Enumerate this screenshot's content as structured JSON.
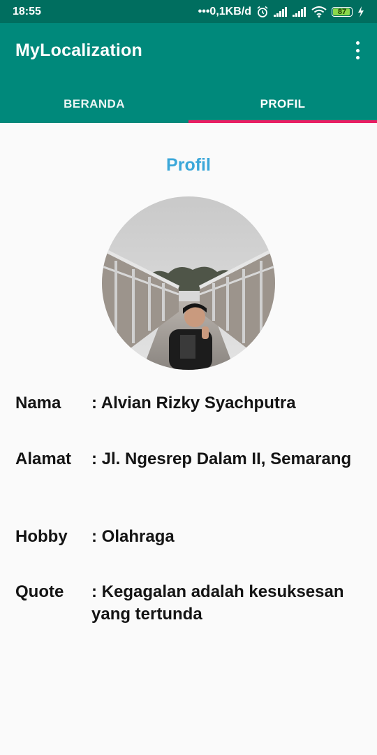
{
  "status": {
    "time": "18:55",
    "network_speed": "•••0,1KB/d",
    "battery": "87"
  },
  "app": {
    "title": "MyLocalization"
  },
  "tabs": [
    {
      "label": "BERANDA",
      "selected": false
    },
    {
      "label": "PROFIL",
      "selected": true
    }
  ],
  "colors": {
    "status_bar": "#006e5f",
    "app_bar": "#00897b",
    "tab_indicator": "#e91e63",
    "heading": "#3ba7d9"
  },
  "profile": {
    "heading": "Profil",
    "photo_icon": "profile-photo",
    "fields": [
      {
        "key": "Nama",
        "value": ": Alvian Rizky Syachputra"
      },
      {
        "key": "Alamat",
        "value": ": Jl. Ngesrep Dalam II, Semarang"
      },
      {
        "key": "Hobby",
        "value": ": Olahraga"
      },
      {
        "key": "Quote",
        "value": ": Kegagalan adalah kesuksesan yang tertunda"
      }
    ]
  }
}
